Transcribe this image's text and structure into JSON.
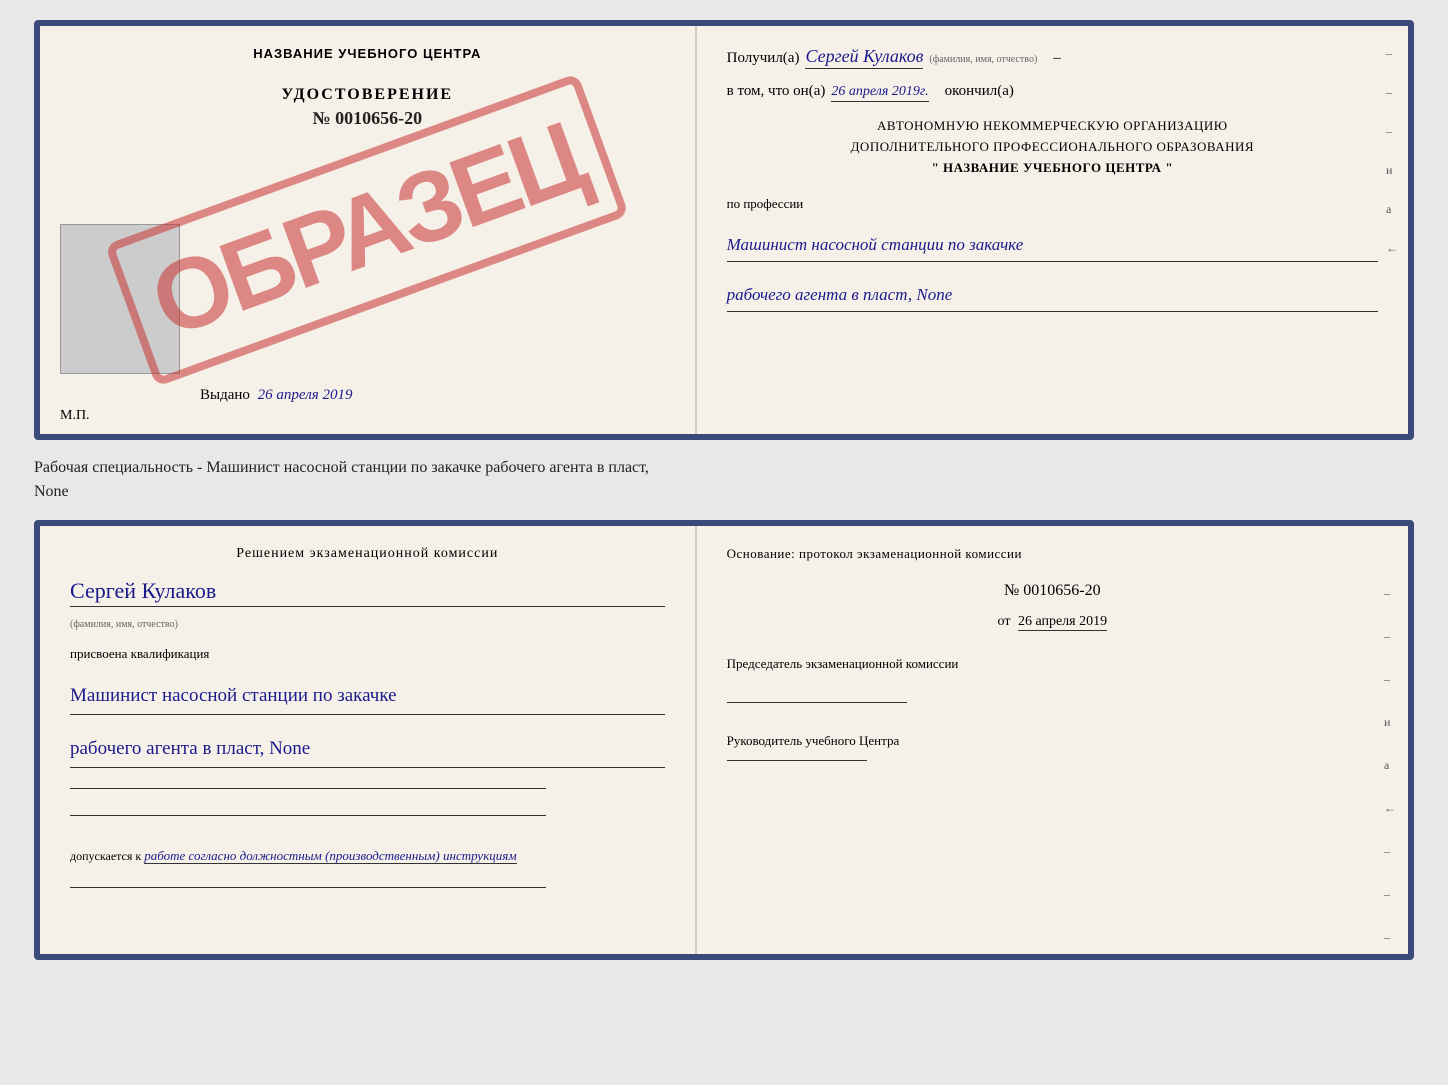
{
  "topDoc": {
    "leftSide": {
      "centerTitle": "НАЗВАНИЕ УЧЕБНОГО ЦЕНТРА",
      "stamplabel": "ОБРАЗЕЦ",
      "udostovTitle": "УДОСТОВЕРЕНИЕ",
      "udostovNumber": "№ 0010656-20",
      "vydano": "Выдано",
      "vydanoDate": "26 апреля 2019",
      "mp": "М.П."
    },
    "rightSide": {
      "poluchilLabel": "Получил(а)",
      "poluchilName": "Сергей Кулаков",
      "fioSub": "(фамилия, имя, отчество)",
      "dash": "–",
      "vtomLabel": "в том, что он(а)",
      "date": "26 апреля 2019г.",
      "okonchilLabel": "окончил(а)",
      "orgLine1": "АВТОНОМНУЮ НЕКОММЕРЧЕСКУЮ ОРГАНИЗАЦИЮ",
      "orgLine2": "ДОПОЛНИТЕЛЬНОГО ПРОФЕССИОНАЛЬНОГО ОБРАЗОВАНИЯ",
      "orgLine3": "\"   НАЗВАНИЕ УЧЕБНОГО ЦЕНТРА   \"",
      "poProfessii": "по профессии",
      "profLine1": "Машинист насосной станции по закачке",
      "profLine2": "рабочего агента в пласт, None"
    }
  },
  "specialtyLabel": "Рабочая специальность - Машинист насосной станции по закачке рабочего агента в пласт,",
  "specialtyLabel2": "None",
  "bottomDoc": {
    "leftSide": {
      "reshenieTitle": "Решением экзаменационной комиссии",
      "personName": "Сергей Кулаков",
      "fioSub": "(фамилия, имя, отчество)",
      "prisvoena": "присвоена квалификация",
      "profLine1": "Машинист насосной станции по закачке",
      "profLine2": "рабочего агента в пласт, None",
      "dopuskaetsyaLabel": "допускается к",
      "dopuskaetsyaText": "работе согласно должностным (производственным) инструкциям"
    },
    "rightSide": {
      "osnovanie": "Основание: протокол экзаменационной комиссии",
      "protokolNumber": "№ 0010656-20",
      "otLabel": "от",
      "otDate": "26 апреля 2019",
      "predsedatelTitle": "Председатель экзаменационной комиссии",
      "rukovoditelTitle": "Руководитель учебного Центра"
    }
  },
  "rightMarks": {
    "top": [
      "–",
      "–",
      "–",
      "и",
      "а",
      "←"
    ],
    "bottom": [
      "–",
      "–",
      "–",
      "и",
      "а",
      "←",
      "–",
      "–",
      "–",
      "–"
    ]
  }
}
